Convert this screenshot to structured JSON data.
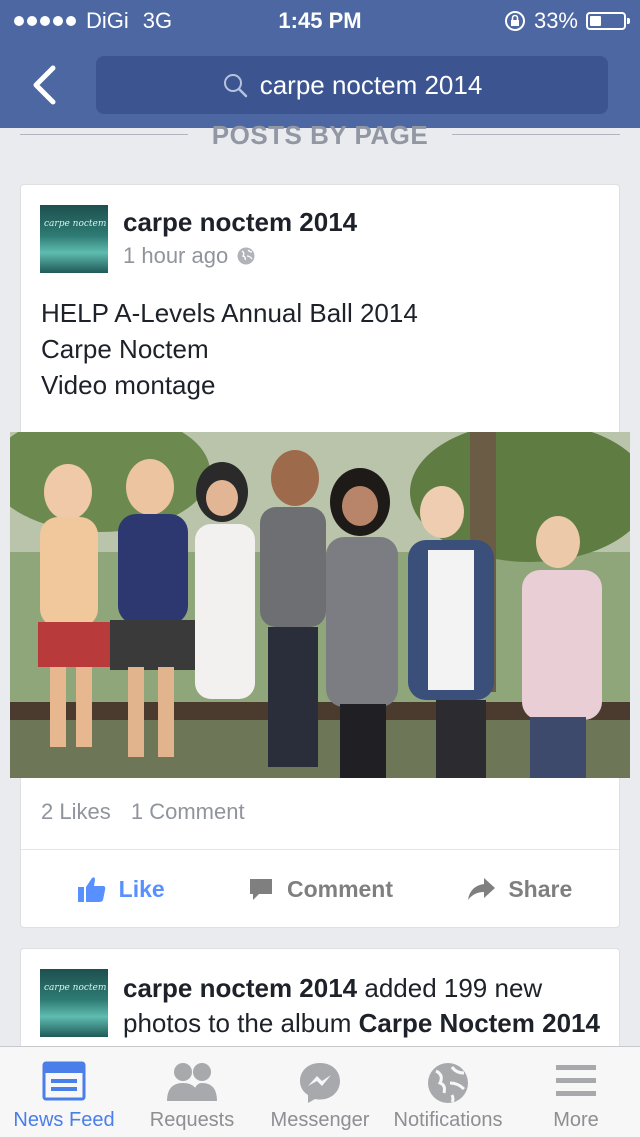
{
  "status_bar": {
    "carrier": "DiGi",
    "network": "3G",
    "time": "1:45 PM",
    "battery": "33%",
    "battery_level": 0.33
  },
  "search": {
    "query": "carpe noctem 2014"
  },
  "section": {
    "title": "POSTS BY PAGE"
  },
  "post1": {
    "page_name": "carpe noctem 2014",
    "avatar_text": "carpe noctem",
    "time": "1 hour ago",
    "text_lines": [
      "HELP A-Levels Annual Ball 2014",
      "Carpe Noctem",
      "Video montage"
    ],
    "likes": "2 Likes",
    "comments": "1 Comment",
    "actions": {
      "like": "Like",
      "comment": "Comment",
      "share": "Share"
    }
  },
  "post2": {
    "page_name": "carpe noctem 2014",
    "avatar_text": "carpe noctem",
    "middle": " added 199 new photos to the album ",
    "album": "Carpe Noctem 2014"
  },
  "tabs": [
    {
      "label": "News Feed",
      "icon": "news-feed-icon",
      "active": true
    },
    {
      "label": "Requests",
      "icon": "requests-icon",
      "active": false
    },
    {
      "label": "Messenger",
      "icon": "messenger-icon",
      "active": false
    },
    {
      "label": "Notifications",
      "icon": "globe-icon",
      "active": false
    },
    {
      "label": "More",
      "icon": "menu-icon",
      "active": false
    }
  ],
  "colors": {
    "brand": "#4c67a1",
    "like": "#5890ff",
    "active_tab": "#4a7ee8"
  }
}
